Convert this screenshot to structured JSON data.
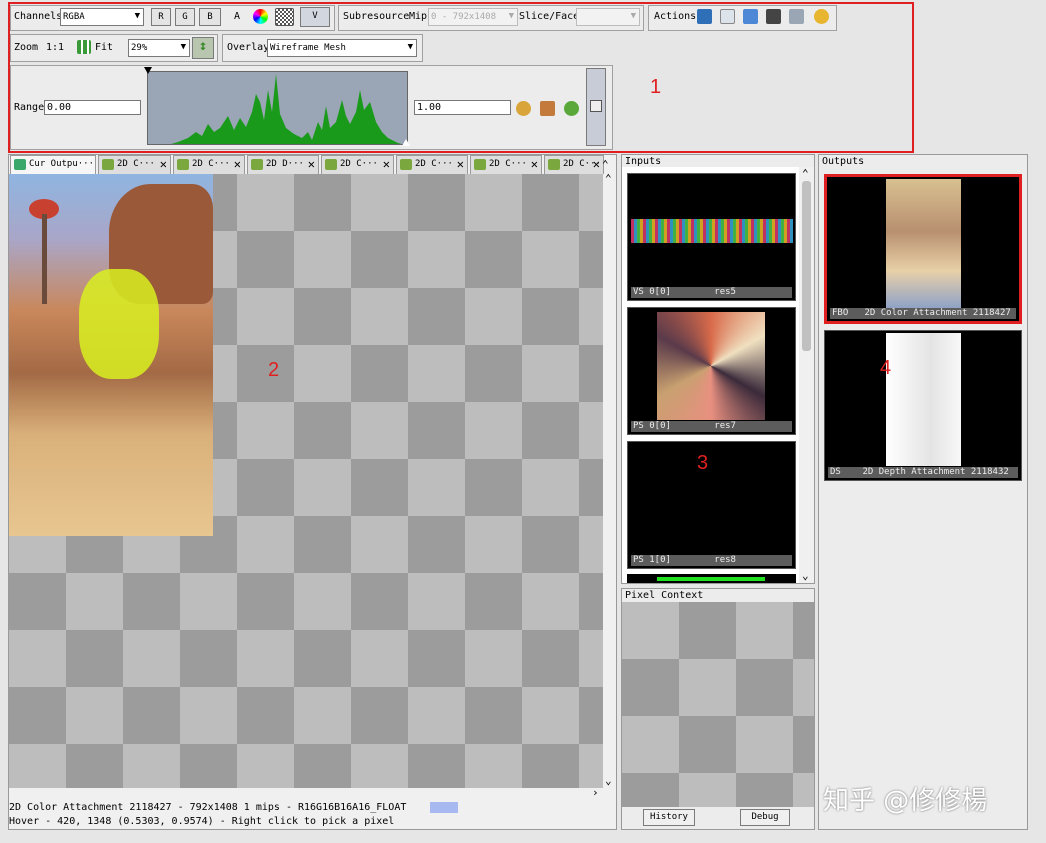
{
  "toolbar": {
    "channels_label": "Channels",
    "channels_value": "RGBA",
    "r": "R",
    "g": "G",
    "b": "B",
    "a": "A",
    "v": "V",
    "subresource_label": "Subresource",
    "mip_label": "Mip",
    "mip_value": "0 - 792x1408",
    "slice_label": "Slice/Face",
    "slice_value": "",
    "actions_label": "Actions",
    "zoom_label": "Zoom",
    "zoom_ratio": "1:1",
    "fit_label": "Fit",
    "zoom_value": "29%",
    "overlay_label": "Overlay",
    "overlay_value": "Wireframe Mesh",
    "range_label": "Range",
    "range_min": "0.00",
    "range_max": "1.00"
  },
  "tabs": [
    {
      "label": "Cur Outpu···"
    },
    {
      "label": "2D C···"
    },
    {
      "label": "2D C···"
    },
    {
      "label": "2D D···"
    },
    {
      "label": "2D C···"
    },
    {
      "label": "2D C···"
    },
    {
      "label": "2D C···"
    },
    {
      "label": "2D C···"
    }
  ],
  "status": {
    "line1": "2D Color Attachment 2118427 - 792x1408 1 mips - R16G16B16A16_FLOAT",
    "line2": "Hover -   420, 1348 (0.5303, 0.9574)  - Right click to pick a pixel"
  },
  "inputs": {
    "title": "Inputs",
    "items": [
      {
        "slot": "VS 0[0]",
        "name": "res5"
      },
      {
        "slot": "PS 0[0]",
        "name": "res7"
      },
      {
        "slot": "PS 1[0]",
        "name": "res8"
      }
    ]
  },
  "pixel_context": {
    "title": "Pixel Context",
    "history": "History",
    "debug": "Debug"
  },
  "outputs": {
    "title": "Outputs",
    "items": [
      {
        "caption": "FBO   2D Color Attachment 2118427"
      },
      {
        "caption": "DS    2D Depth Attachment 2118432"
      }
    ]
  },
  "annotations": {
    "n1": "1",
    "n2": "2",
    "n3": "3",
    "n4": "4"
  },
  "watermark": "知乎 @修修楊",
  "colors": {
    "annotation": "#e02020",
    "histogram": "#1a9a1a",
    "status_swatch": "#a8b8f0"
  }
}
